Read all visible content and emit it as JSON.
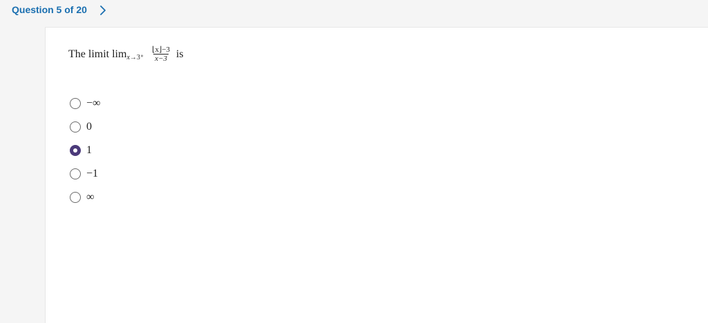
{
  "header": {
    "question_counter": "Question 5 of 20",
    "next_icon": "chevron-right-icon"
  },
  "question": {
    "prefix": "The limit lim",
    "subscript_var": "x",
    "subscript_rest": "→3⁺",
    "numerator": "⌊x⌋−3",
    "denominator": "x−3",
    "suffix": "is"
  },
  "options": [
    {
      "label": "−∞",
      "selected": false
    },
    {
      "label": "0",
      "selected": false
    },
    {
      "label": "1",
      "selected": true
    },
    {
      "label": "−1",
      "selected": false
    },
    {
      "label": "∞",
      "selected": false
    }
  ],
  "colors": {
    "accent": "#1a6fb0",
    "selected_radio": "#4b3a7a"
  }
}
